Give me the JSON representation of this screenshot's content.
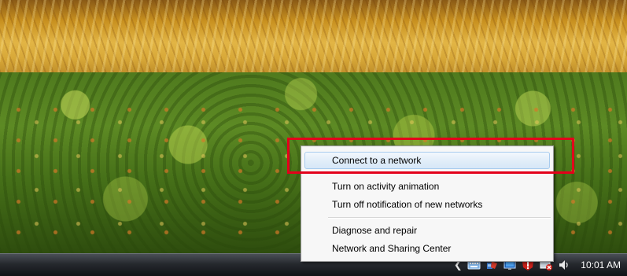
{
  "context_menu": {
    "items": [
      {
        "label": "Connect to a network",
        "highlighted": true
      },
      {
        "label": "Turn on activity animation"
      },
      {
        "label": "Turn off notification of new networks"
      },
      {
        "label": "Diagnose and repair"
      },
      {
        "label": "Network and Sharing Center"
      }
    ]
  },
  "taskbar": {
    "tray": {
      "icons": [
        "show-hidden-icons-chevron",
        "keyboard-language-icon",
        "security-shield-icon",
        "network-monitor-icon",
        "security-alert-icon",
        "network-disconnected-icon",
        "volume-icon"
      ],
      "clock": "10:01 AM"
    }
  },
  "colors": {
    "annotation": "#e3001b",
    "menu_highlight_border": "#a8cbee",
    "taskbar": "#1b1d21"
  }
}
